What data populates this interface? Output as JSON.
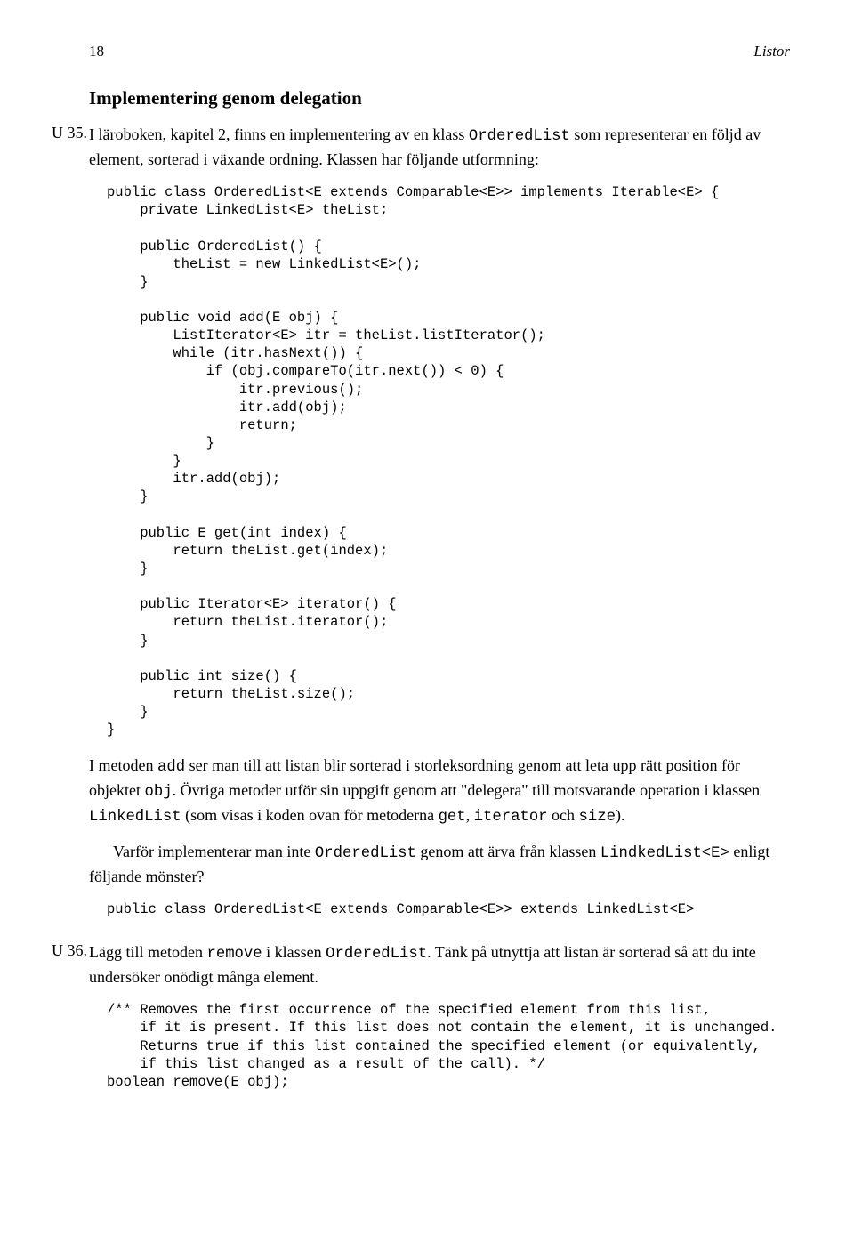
{
  "header": {
    "page_number": "18",
    "chapter_title": "Listor"
  },
  "section_title": "Implementering genom delegation",
  "ex35": {
    "label": "U 35.",
    "para1_pre": "I läroboken, kapitel 2, finns en implementering av en klass ",
    "para1_code1": "OrderedList",
    "para1_post": " som representerar en följd av element, sorterad i växande ordning. Klassen har följande utformning:",
    "code1": "public class OrderedList<E extends Comparable<E>> implements Iterable<E> {\n    private LinkedList<E> theList;\n\n    public OrderedList() {\n        theList = new LinkedList<E>();\n    }\n\n    public void add(E obj) {\n        ListIterator<E> itr = theList.listIterator();\n        while (itr.hasNext()) {\n            if (obj.compareTo(itr.next()) < 0) {\n                itr.previous();\n                itr.add(obj);\n                return;\n            }\n        }\n        itr.add(obj);\n    }\n\n    public E get(int index) {\n        return theList.get(index);\n    }\n\n    public Iterator<E> iterator() {\n        return theList.iterator();\n    }\n\n    public int size() {\n        return theList.size();\n    }\n}",
    "para2_pre": "I metoden ",
    "para2_c1": "add",
    "para2_m1": " ser man till att listan blir sorterad i storleksordning genom att leta upp rätt position för objektet ",
    "para2_c2": "obj",
    "para2_m2": ". Övriga metoder utför sin uppgift genom att \"delegera\" till motsvarande operation i klassen ",
    "para2_c3": "LinkedList",
    "para2_m3": " (som visas i koden ovan för metoderna ",
    "para2_c4": "get",
    "para2_m4": ", ",
    "para2_c5": "iterator",
    "para2_m5": " och ",
    "para2_c6": "size",
    "para2_m6": ").",
    "para3_pre": "Varför implementerar man inte ",
    "para3_c1": "OrderedList",
    "para3_m1": " genom att ärva från klassen ",
    "para3_c2": "LindkedList<E>",
    "para3_post": " enligt följande mönster?",
    "code2": "public class OrderedList<E extends Comparable<E>> extends LinkedList<E>"
  },
  "ex36": {
    "label": "U 36.",
    "para1_pre": "Lägg till metoden ",
    "para1_c1": "remove",
    "para1_m1": " i klassen ",
    "para1_c2": "OrderedList",
    "para1_post": ". Tänk på utnyttja att listan är sorterad så att du inte undersöker onödigt många element.",
    "code1": "/** Removes the first occurrence of the specified element from this list,\n    if it is present. If this list does not contain the element, it is unchanged.\n    Returns true if this list contained the specified element (or equivalently,\n    if this list changed as a result of the call). */\nboolean remove(E obj);"
  }
}
